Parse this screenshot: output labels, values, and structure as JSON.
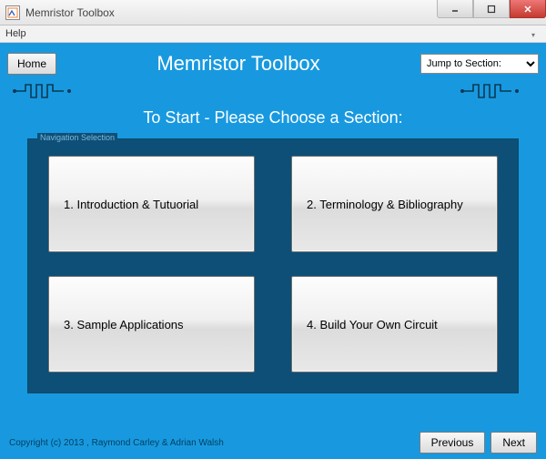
{
  "window": {
    "title": "Memristor Toolbox"
  },
  "menu": {
    "help": "Help"
  },
  "toolbar": {
    "home_label": "Home",
    "app_title": "Memristor Toolbox",
    "jump_placeholder": "Jump to Section:"
  },
  "subtitle": "To Start - Please Choose a Section:",
  "nav": {
    "legend": "Navigation Selection",
    "buttons": [
      "1. Introduction & Tutuorial",
      "2. Terminology & Bibliography",
      "3. Sample Applications",
      "4. Build Your Own Circuit"
    ]
  },
  "footer": {
    "copyright": "Copyright (c) 2013 , Raymond Carley & Adrian Walsh",
    "previous": "Previous",
    "next": "Next"
  },
  "colors": {
    "main_bg": "#1899df",
    "panel_bg": "#0d4f77"
  }
}
